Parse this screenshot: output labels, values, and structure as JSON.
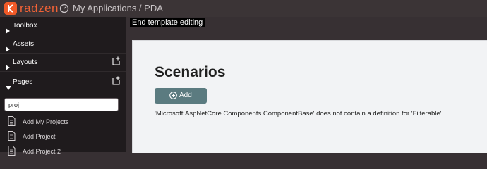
{
  "header": {
    "brand": "radzen",
    "breadcrumb": "My Applications / PDA"
  },
  "sidebar": {
    "sections": [
      {
        "label": "Toolbox"
      },
      {
        "label": "Assets"
      },
      {
        "label": "Layouts"
      },
      {
        "label": "Pages"
      }
    ],
    "search_value": "proj",
    "pages": [
      {
        "label": "Add My Projects"
      },
      {
        "label": "Add Project"
      },
      {
        "label": "Add Project 2"
      }
    ]
  },
  "canvas": {
    "tooltip": "End template editing",
    "title": "Scenarios",
    "add_label": "Add",
    "error_message": "'Microsoft.AspNetCore.Components.ComponentBase' does not contain a definition for 'Filterable'"
  },
  "colors": {
    "brand": "#f05a28",
    "sidebar_bg": "#1f1b1d",
    "button": "#5b7b80"
  }
}
